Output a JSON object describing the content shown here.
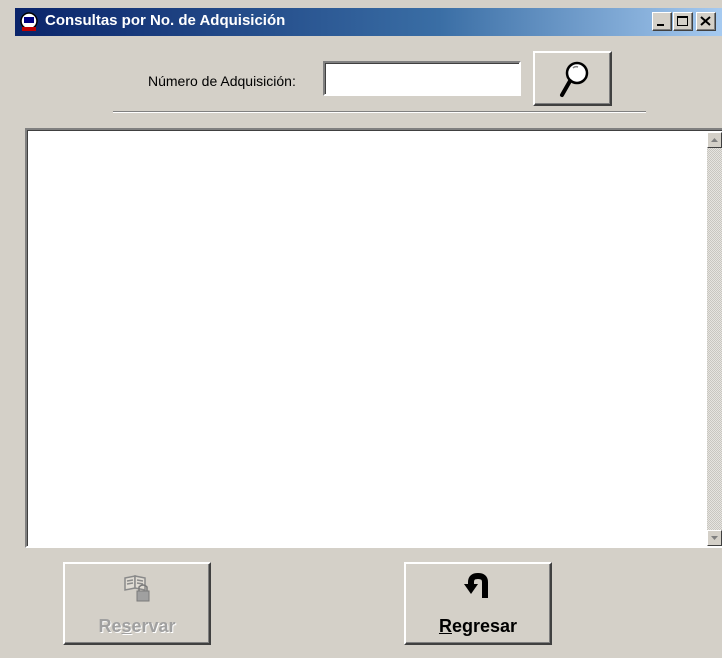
{
  "window": {
    "title": "Consultas por No. de Adquisición",
    "app_icon": "library-app-icon",
    "controls": [
      "minimize",
      "maximize",
      "close"
    ]
  },
  "search": {
    "label": "Número de Adquisición:",
    "value": "",
    "button_icon": "magnifier-icon"
  },
  "results": {
    "items": []
  },
  "buttons": {
    "reservar": {
      "label_before": "Re",
      "label_mnemonic": "s",
      "label_after": "ervar",
      "enabled": false,
      "icon": "book-lock-icon"
    },
    "regresar": {
      "label_before": "",
      "label_mnemonic": "R",
      "label_after": "egresar",
      "enabled": true,
      "icon": "return-arrow-icon"
    }
  },
  "colors": {
    "titlebar_start": "#0a246a",
    "titlebar_end": "#a6caf0",
    "face": "#d4d0c8",
    "disabled_text": "#a0a0a0"
  }
}
